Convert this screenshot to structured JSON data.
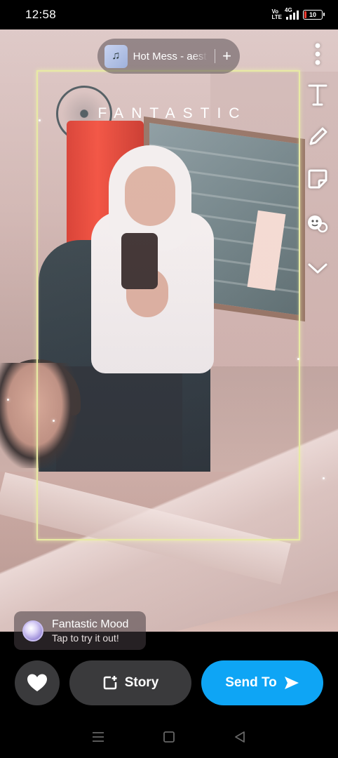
{
  "status_bar": {
    "time": "12:58",
    "volte_top": "Vo",
    "volte_bottom": "LTE",
    "network": "4G",
    "battery_level": "10",
    "battery_fraction": 0.1,
    "battery_color": "#ff3b30"
  },
  "music": {
    "title": "Hot Mess - aesthetic",
    "add_symbol": "+",
    "art_icon": "music-album-art"
  },
  "caption": {
    "text": "FANTASTIC"
  },
  "toolbar": {
    "items": [
      {
        "name": "more-options-icon"
      },
      {
        "name": "text-tool-icon"
      },
      {
        "name": "pencil-icon"
      },
      {
        "name": "sticker-icon"
      },
      {
        "name": "lens-icon"
      },
      {
        "name": "chevron-down-icon"
      }
    ]
  },
  "mood": {
    "title": "Fantastic Mood",
    "subtitle": "Tap to try it out!"
  },
  "actions": {
    "story_label": "Story",
    "send_label": "Send To",
    "send_color": "#0ea5f5",
    "button_color": "#3a3a3c"
  },
  "nav": {
    "items": [
      "menu-icon",
      "home-square-icon",
      "back-triangle-icon"
    ]
  }
}
